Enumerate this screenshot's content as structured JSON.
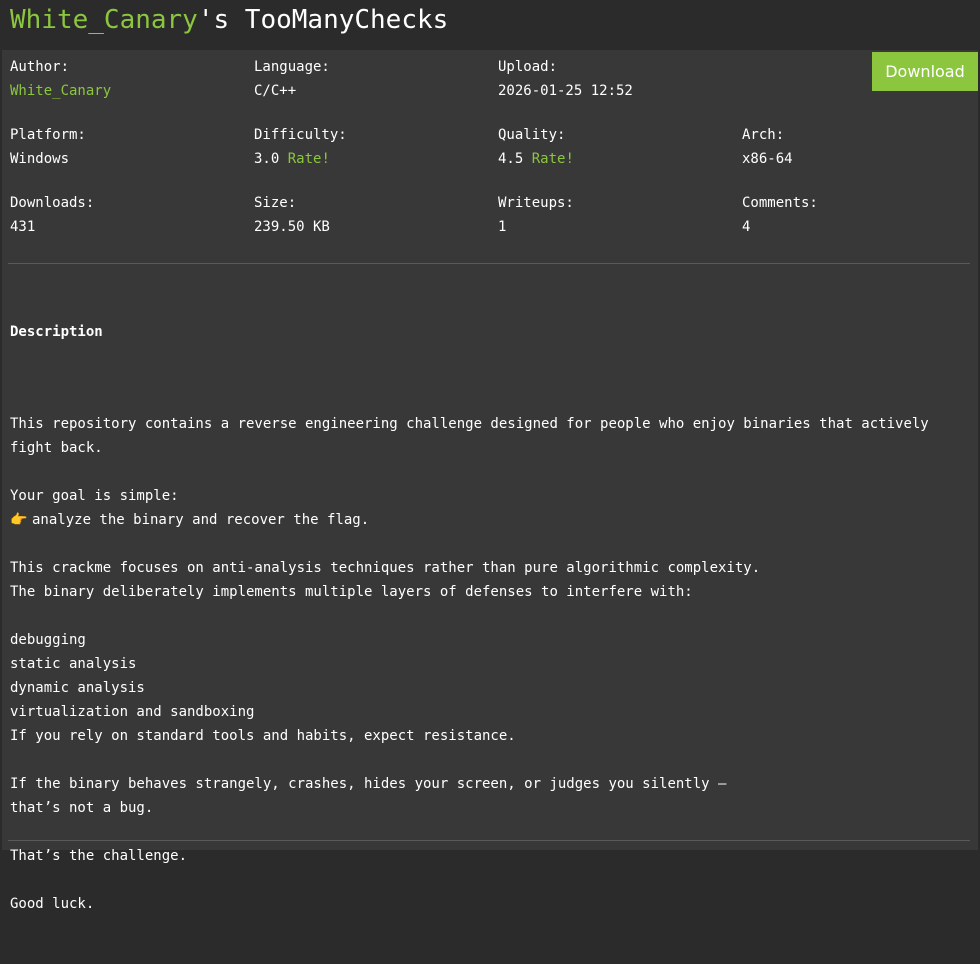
{
  "title": {
    "author": "White_Canary",
    "suffix": "'s TooManyChecks"
  },
  "download_label": "Download",
  "meta": {
    "author": {
      "label": "Author:",
      "value": "White_Canary"
    },
    "language": {
      "label": "Language:",
      "value": "C/C++"
    },
    "upload": {
      "label": "Upload:",
      "value": "2026-01-25 12:52"
    },
    "platform": {
      "label": "Platform:",
      "value": "Windows"
    },
    "difficulty": {
      "label": "Difficulty:",
      "value": "3.0",
      "rate": "Rate!"
    },
    "quality": {
      "label": "Quality:",
      "value": "4.5",
      "rate": "Rate!"
    },
    "arch": {
      "label": "Arch:",
      "value": "x86-64"
    },
    "downloads": {
      "label": "Downloads:",
      "value": "431"
    },
    "size": {
      "label": "Size:",
      "value": "239.50 KB"
    },
    "writeups": {
      "label": "Writeups:",
      "value": "1"
    },
    "comments": {
      "label": "Comments:",
      "value": "4"
    }
  },
  "description": {
    "heading": "Description",
    "lines": [
      "This repository contains a reverse engineering challenge designed for people who enjoy binaries that actively",
      "fight back.",
      "",
      "Your goal is simple:",
      "analyze the binary and recover the flag.",
      "",
      "This crackme focuses on anti-analysis techniques rather than pure algorithmic complexity.",
      "The binary deliberately implements multiple layers of defenses to interfere with:",
      "",
      "debugging",
      "static analysis",
      "dynamic analysis",
      "virtualization and sandboxing",
      "If you rely on standard tools and habits, expect resistance.",
      "",
      "If the binary behaves strangely, crashes, hides your screen, or judges you silently —",
      "that’s not a bug.",
      "",
      "That’s the challenge.",
      "",
      "Good luck."
    ],
    "point_icon": "👉"
  },
  "colors": {
    "accent": "#8cc63f",
    "background": "#2b2b2b",
    "panel": "#383838"
  }
}
